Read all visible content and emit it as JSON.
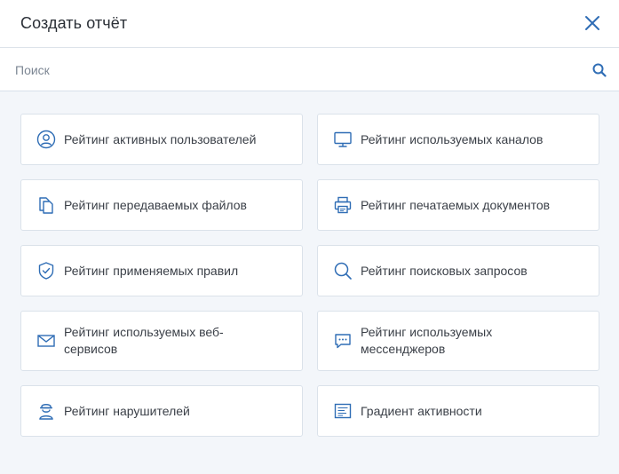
{
  "dialog": {
    "title": "Создать отчёт",
    "close_icon": "close-icon"
  },
  "search": {
    "placeholder": "Поиск",
    "value": "",
    "icon": "search-icon"
  },
  "colors": {
    "accent": "#2f6db5",
    "background": "#f3f6fa",
    "card_border": "#dbe2ea"
  },
  "reports": [
    {
      "label": "Рейтинг активных пользователей",
      "icon": "user-circle-icon"
    },
    {
      "label": "Рейтинг используемых каналов",
      "icon": "monitor-icon"
    },
    {
      "label": "Рейтинг передаваемых файлов",
      "icon": "files-icon"
    },
    {
      "label": "Рейтинг печатаемых документов",
      "icon": "printer-icon"
    },
    {
      "label": "Рейтинг применяемых правил",
      "icon": "shield-check-icon"
    },
    {
      "label": "Рейтинг поисковых запросов",
      "icon": "magnifier-icon"
    },
    {
      "label": "Рейтинг используемых веб-сервисов",
      "icon": "mail-icon"
    },
    {
      "label": "Рейтинг используемых мессенджеров",
      "icon": "chat-icon"
    },
    {
      "label": "Рейтинг нарушителей",
      "icon": "intruder-icon"
    },
    {
      "label": "Градиент активности",
      "icon": "document-lines-icon"
    }
  ]
}
